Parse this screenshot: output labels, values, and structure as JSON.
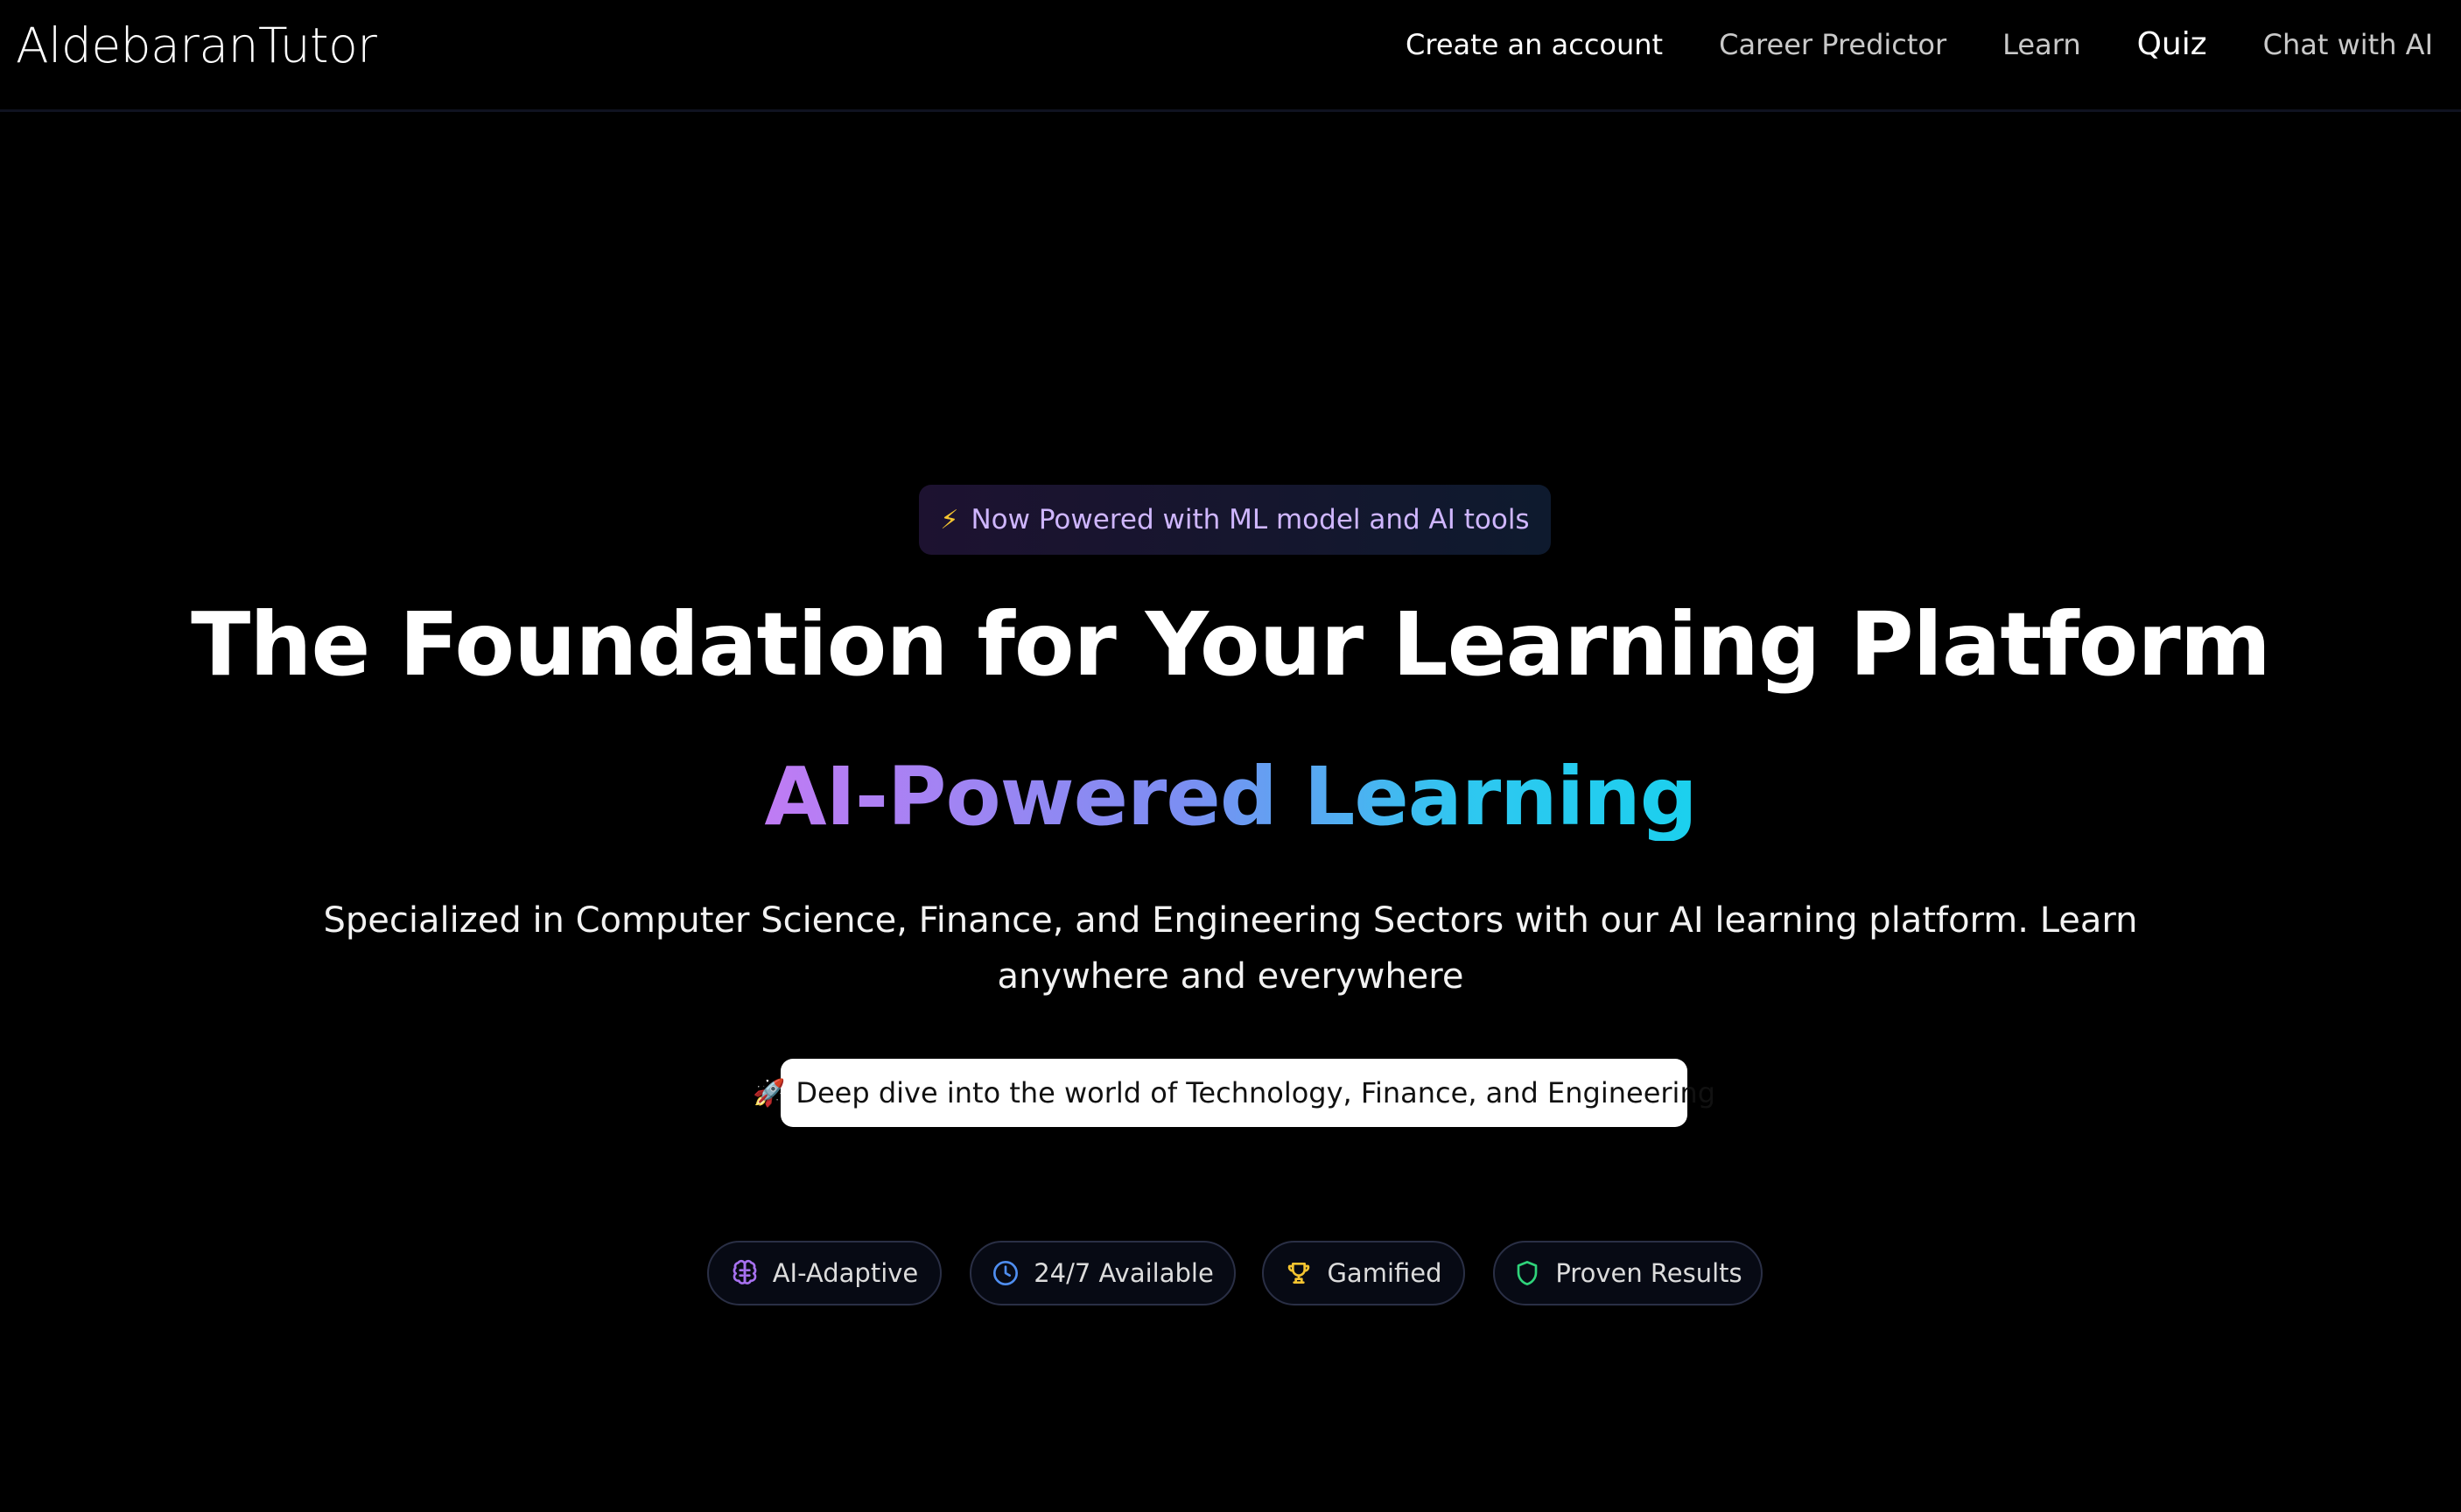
{
  "header": {
    "brand": "AldebaranTutor",
    "nav": [
      {
        "label": "Create an account"
      },
      {
        "label": "Career Predictor"
      },
      {
        "label": "Learn"
      },
      {
        "label": "Quiz"
      },
      {
        "label": "Chat with AI"
      }
    ]
  },
  "hero": {
    "announcement": {
      "icon": "lightning-icon",
      "text": "Now Powered with ML model and AI tools"
    },
    "headline": "The Foundation for Your Learning Platform",
    "subheadline": "AI-Powered Learning",
    "description": "Specialized in Computer Science, Finance, and Engineering Sectors with our AI learning platform. Learn anywhere and everywhere",
    "cta": {
      "icon": "rocket-icon",
      "label": "Deep dive into the world of Technology, Finance, and Engineering"
    }
  },
  "features": [
    {
      "label": "AI-Adaptive",
      "icon": "brain-icon",
      "color": "#a771f0"
    },
    {
      "label": "24/7 Available",
      "icon": "clock-icon",
      "color": "#4f8ef0"
    },
    {
      "label": "Gamified",
      "icon": "trophy-icon",
      "color": "#f4c430"
    },
    {
      "label": "Proven Results",
      "icon": "shield-icon",
      "color": "#2fd37a"
    }
  ],
  "colors": {
    "background": "#000000",
    "accent_purple": "#c07bf4",
    "accent_cyan": "#1bd0ee",
    "announce_text": "#cfb6ff"
  }
}
